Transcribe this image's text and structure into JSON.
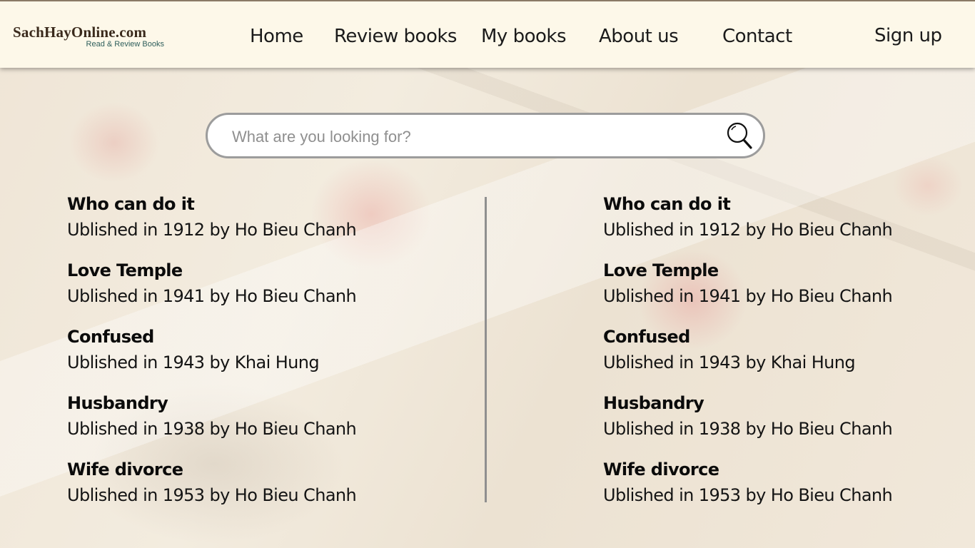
{
  "header": {
    "logo_title": "SachHayOnline.com",
    "logo_subtitle": "Read & Review Books",
    "nav": [
      "Home",
      "Review books",
      "My books",
      "About us",
      "Contact"
    ],
    "signup_label": "Sign up"
  },
  "search": {
    "placeholder": "What are you looking for?",
    "icon": "search-icon"
  },
  "books_left": [
    {
      "title": "Who can do it",
      "meta": "Ublished in 1912 by Ho Bieu Chanh"
    },
    {
      "title": "Love Temple",
      "meta": "Ublished in 1941 by Ho Bieu Chanh"
    },
    {
      "title": "Confused",
      "meta": "Ublished in 1943 by Khai Hung"
    },
    {
      "title": "Husbandry",
      "meta": "Ublished in 1938 by Ho Bieu Chanh"
    },
    {
      "title": "Wife divorce",
      "meta": "Ublished in 1953 by Ho Bieu Chanh"
    }
  ],
  "books_right": [
    {
      "title": "Who can do it",
      "meta": "Ublished in 1912 by Ho Bieu Chanh"
    },
    {
      "title": "Love Temple",
      "meta": "Ublished in 1941 by Ho Bieu Chanh"
    },
    {
      "title": "Confused",
      "meta": "Ublished in 1943 by Khai Hung"
    },
    {
      "title": "Husbandry",
      "meta": "Ublished in 1938 by Ho Bieu Chanh"
    },
    {
      "title": "Wife divorce",
      "meta": "Ublished in 1953 by Ho Bieu Chanh"
    }
  ],
  "colors": {
    "header_bg": "#fdf8e9",
    "logo_text": "#3a2a1c",
    "logo_sub": "#2f5f5c",
    "search_border": "#9c9c9c"
  }
}
